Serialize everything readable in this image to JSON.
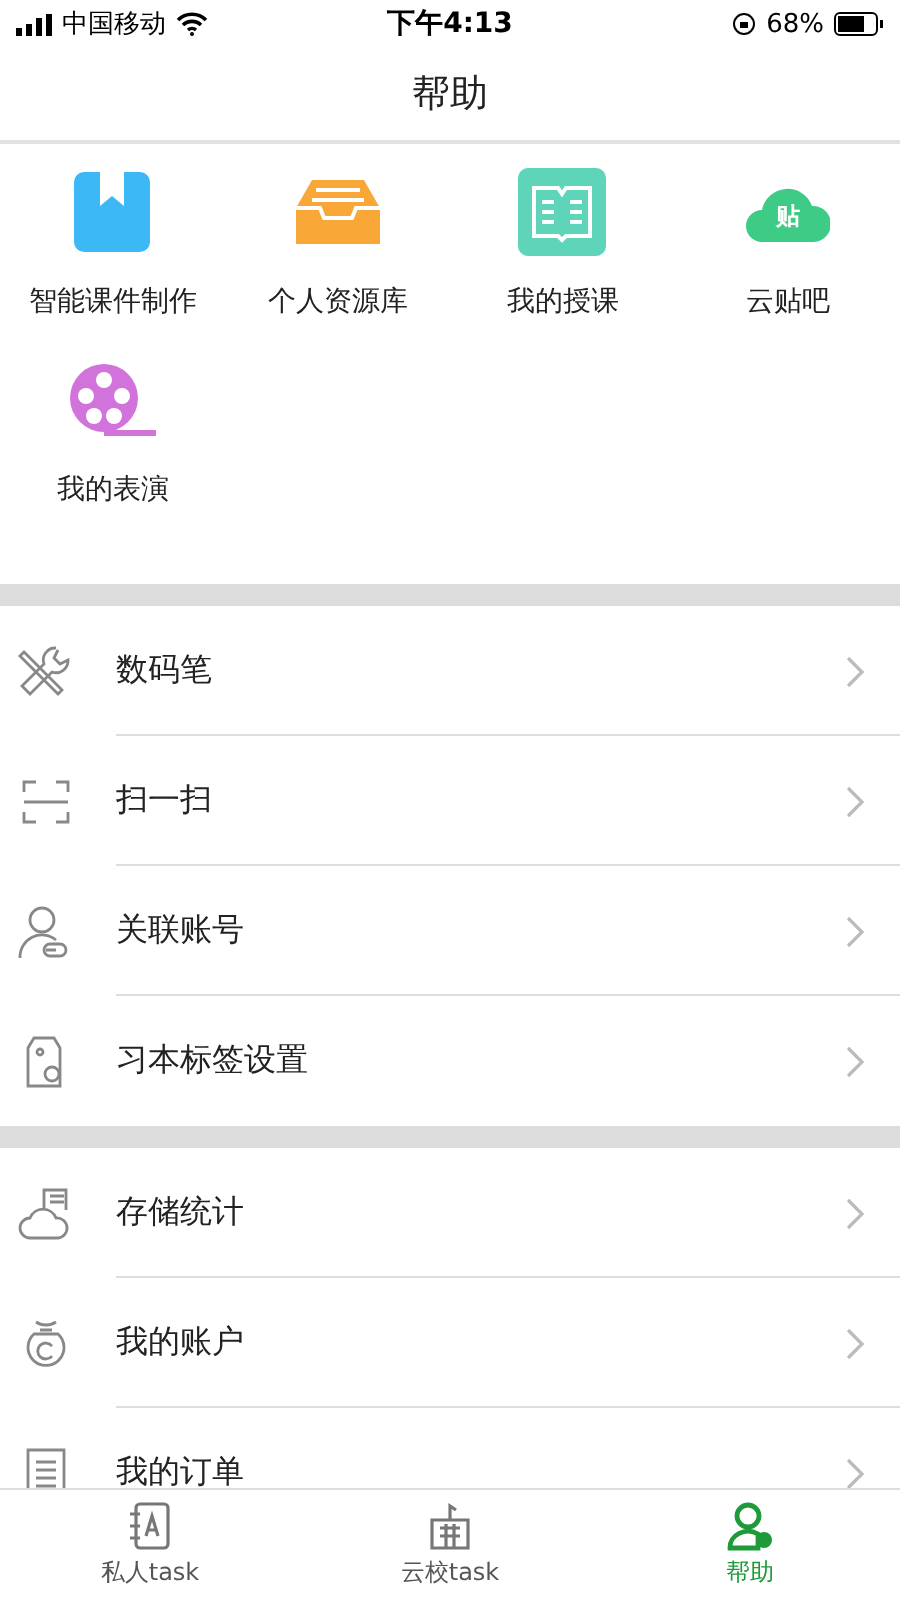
{
  "status_bar": {
    "carrier": "中国移动",
    "time": "下午4:13",
    "battery": "68%"
  },
  "title": "帮助",
  "shortcuts": [
    {
      "kind": "bookmark",
      "label": "智能课件制作"
    },
    {
      "kind": "tray",
      "label": "个人资源库"
    },
    {
      "kind": "book",
      "label": "我的授课"
    },
    {
      "kind": "cloud",
      "label": "云贴吧",
      "icon_text": "贴"
    },
    {
      "kind": "film",
      "label": "我的表演"
    }
  ],
  "menu_groups": [
    [
      {
        "kind": "tools",
        "label": "数码笔"
      },
      {
        "kind": "scan",
        "label": "扫一扫"
      },
      {
        "kind": "user-link",
        "label": "关联账号"
      },
      {
        "kind": "tag",
        "label": "习本标签设置"
      }
    ],
    [
      {
        "kind": "cloud-stack",
        "label": "存储统计"
      },
      {
        "kind": "bag",
        "label": "我的账户"
      },
      {
        "kind": "document",
        "label": "我的订单"
      }
    ]
  ],
  "tabs": [
    {
      "kind": "notebook",
      "label": "私人task",
      "selected": false
    },
    {
      "kind": "building",
      "label": "云校task",
      "selected": false
    },
    {
      "kind": "user",
      "label": "帮助",
      "selected": true
    }
  ]
}
